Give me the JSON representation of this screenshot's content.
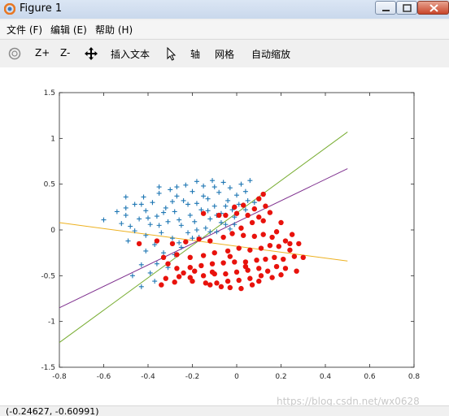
{
  "window": {
    "title": "Figure 1"
  },
  "menu": {
    "items": [
      {
        "label": "文件 (F)"
      },
      {
        "label": "编辑 (E)"
      },
      {
        "label": "帮助 (H)"
      }
    ]
  },
  "toolbar": {
    "zoom_in_label": "Z+",
    "zoom_out_label": "Z-",
    "insert_text_label": "插入文本",
    "axis_label": "轴",
    "grid_label": "网格",
    "autoscale_label": "自动缩放",
    "icons": [
      "rotate-icon",
      "pan-icon",
      "pointer-icon"
    ]
  },
  "status": {
    "coordinates": "(-0.24627, -0.60991)"
  },
  "watermark": {
    "text": "https://blog.csdn.net/wx0628"
  },
  "colors": {
    "class_a": "#1f77b4",
    "class_b": "#e8120c",
    "line_green": "#77ac30",
    "line_purple": "#7e2f8e",
    "line_orange": "#edb120"
  },
  "chart_data": {
    "type": "scatter",
    "title": "",
    "xlabel": "",
    "ylabel": "",
    "xlim": [
      -0.8,
      0.8
    ],
    "ylim": [
      -1.5,
      1.5
    ],
    "xticks": [
      "-0.8",
      "-0.6",
      "-0.4",
      "-0.2",
      "0",
      "0.2",
      "0.4",
      "0.6",
      "0.8"
    ],
    "yticks": [
      "1.5",
      "1",
      "0.5",
      "0",
      "-0.5",
      "-1",
      "-1.5"
    ],
    "grid": false,
    "series": [
      {
        "marker": "plus",
        "color": "#1f77b4",
        "points": [
          [
            -0.6,
            0.11
          ],
          [
            -0.54,
            0.2
          ],
          [
            -0.52,
            0.07
          ],
          [
            -0.5,
            0.16
          ],
          [
            -0.5,
            0.36
          ],
          [
            -0.49,
            -0.12
          ],
          [
            -0.48,
            0.04
          ],
          [
            -0.46,
            -0.01
          ],
          [
            -0.46,
            0.28
          ],
          [
            -0.44,
            0.12
          ],
          [
            -0.42,
            0.36
          ],
          [
            -0.41,
            -0.23
          ],
          [
            -0.41,
            0.21
          ],
          [
            -0.39,
            0.06
          ],
          [
            -0.38,
            0.3
          ],
          [
            -0.37,
            -0.16
          ],
          [
            -0.36,
            0.15
          ],
          [
            -0.35,
            0.4
          ],
          [
            -0.34,
            -0.03
          ],
          [
            -0.33,
            -0.25
          ],
          [
            -0.32,
            0.24
          ],
          [
            -0.31,
            0.09
          ],
          [
            -0.3,
            0.44
          ],
          [
            -0.29,
            -0.09
          ],
          [
            -0.28,
            0.2
          ],
          [
            -0.27,
            0.37
          ],
          [
            -0.26,
            -0.14
          ],
          [
            -0.25,
            0.05
          ],
          [
            -0.24,
            0.32
          ],
          [
            -0.23,
            0.49
          ],
          [
            -0.22,
            -0.03
          ],
          [
            -0.21,
            0.16
          ],
          [
            -0.2,
            0.42
          ],
          [
            -0.19,
            0.09
          ],
          [
            -0.18,
            0.29
          ],
          [
            -0.17,
            -0.08
          ],
          [
            -0.16,
            0.22
          ],
          [
            -0.15,
            0.48
          ],
          [
            -0.14,
            0.02
          ],
          [
            -0.13,
            0.34
          ],
          [
            -0.12,
            0.12
          ],
          [
            -0.11,
            0.54
          ],
          [
            -0.1,
            0.26
          ],
          [
            -0.09,
            -0.02
          ],
          [
            -0.08,
            0.41
          ],
          [
            -0.07,
            0.18
          ],
          [
            -0.06,
            0.52
          ],
          [
            -0.05,
            0.06
          ],
          [
            -0.04,
            0.32
          ],
          [
            -0.03,
            0.46
          ],
          [
            -0.02,
            0.22
          ],
          [
            -0.01,
            0.14
          ],
          [
            0.0,
            0.38
          ],
          [
            0.01,
            0.28
          ],
          [
            0.02,
            0.5
          ],
          [
            0.04,
            0.42
          ],
          [
            0.05,
            0.32
          ],
          [
            0.06,
            0.54
          ],
          [
            -0.37,
            -0.56
          ],
          [
            -0.43,
            -0.38
          ],
          [
            -0.47,
            -0.5
          ],
          [
            -0.39,
            -0.47
          ],
          [
            -0.25,
            -0.19
          ],
          [
            -0.36,
            -0.37
          ],
          [
            -0.28,
            -0.27
          ],
          [
            -0.43,
            -0.62
          ],
          [
            -0.31,
            -0.41
          ],
          [
            -0.2,
            -0.09
          ],
          [
            -0.5,
            0.24
          ],
          [
            -0.43,
            0.28
          ],
          [
            -0.35,
            0.47
          ],
          [
            -0.27,
            0.47
          ],
          [
            -0.18,
            0.53
          ],
          [
            -0.1,
            0.47
          ],
          [
            -0.15,
            0.37
          ],
          [
            -0.22,
            0.28
          ],
          [
            -0.05,
            0.26
          ],
          [
            -0.03,
            0.01
          ],
          [
            -0.07,
            0.08
          ],
          [
            -0.12,
            -0.02
          ],
          [
            -0.18,
            0.0
          ],
          [
            -0.26,
            0.11
          ],
          [
            -0.35,
            0.05
          ],
          [
            -0.41,
            -0.06
          ],
          [
            -0.4,
            0.13
          ],
          [
            -0.33,
            0.19
          ],
          [
            -0.29,
            0.31
          ],
          [
            -0.13,
            0.21
          ],
          [
            -0.09,
            0.16
          ],
          [
            0.04,
            0.22
          ],
          [
            0.08,
            0.3
          ],
          [
            -0.01,
            0.06
          ]
        ]
      },
      {
        "marker": "dot",
        "color": "#e8120c",
        "points": [
          [
            0.12,
            0.39
          ],
          [
            0.1,
            0.34
          ],
          [
            0.13,
            0.26
          ],
          [
            0.08,
            0.23
          ],
          [
            0.03,
            0.27
          ],
          [
            -0.01,
            0.25
          ],
          [
            0.15,
            0.19
          ],
          [
            0.1,
            0.14
          ],
          [
            0.05,
            0.16
          ],
          [
            0.0,
            0.18
          ],
          [
            -0.05,
            0.16
          ],
          [
            -0.08,
            0.16
          ],
          [
            -0.15,
            0.18
          ],
          [
            0.12,
            0.1
          ],
          [
            0.07,
            0.08
          ],
          [
            0.02,
            0.02
          ],
          [
            0.2,
            0.08
          ],
          [
            0.18,
            -0.02
          ],
          [
            0.12,
            -0.05
          ],
          [
            0.08,
            -0.07
          ],
          [
            0.03,
            -0.06
          ],
          [
            -0.02,
            -0.04
          ],
          [
            -0.06,
            -0.08
          ],
          [
            -0.12,
            -0.12
          ],
          [
            -0.17,
            -0.1
          ],
          [
            -0.23,
            -0.13
          ],
          [
            -0.29,
            -0.15
          ],
          [
            -0.36,
            -0.12
          ],
          [
            -0.44,
            -0.15
          ],
          [
            0.25,
            -0.05
          ],
          [
            0.22,
            -0.12
          ],
          [
            0.28,
            -0.15
          ],
          [
            0.19,
            -0.18
          ],
          [
            0.15,
            -0.17
          ],
          [
            0.11,
            -0.2
          ],
          [
            0.06,
            -0.22
          ],
          [
            0.01,
            -0.2
          ],
          [
            -0.04,
            -0.23
          ],
          [
            -0.1,
            -0.25
          ],
          [
            -0.15,
            -0.28
          ],
          [
            -0.21,
            -0.3
          ],
          [
            -0.27,
            -0.27
          ],
          [
            -0.33,
            -0.3
          ],
          [
            0.3,
            -0.3
          ],
          [
            0.26,
            -0.29
          ],
          [
            0.24,
            -0.22
          ],
          [
            0.21,
            -0.32
          ],
          [
            0.17,
            -0.3
          ],
          [
            0.13,
            -0.32
          ],
          [
            0.09,
            -0.33
          ],
          [
            0.04,
            -0.35
          ],
          [
            -0.01,
            -0.35
          ],
          [
            -0.06,
            -0.36
          ],
          [
            -0.11,
            -0.37
          ],
          [
            -0.16,
            -0.39
          ],
          [
            -0.21,
            -0.41
          ],
          [
            -0.27,
            -0.42
          ],
          [
            -0.31,
            -0.37
          ],
          [
            0.27,
            -0.45
          ],
          [
            0.22,
            -0.42
          ],
          [
            0.18,
            -0.4
          ],
          [
            0.14,
            -0.45
          ],
          [
            0.1,
            -0.42
          ],
          [
            0.05,
            -0.44
          ],
          [
            0.0,
            -0.46
          ],
          [
            -0.05,
            -0.48
          ],
          [
            -0.1,
            -0.48
          ],
          [
            -0.15,
            -0.5
          ],
          [
            -0.21,
            -0.52
          ],
          [
            -0.26,
            -0.51
          ],
          [
            -0.32,
            -0.53
          ],
          [
            0.2,
            -0.49
          ],
          [
            0.16,
            -0.52
          ],
          [
            0.11,
            -0.5
          ],
          [
            0.06,
            -0.53
          ],
          [
            0.01,
            -0.55
          ],
          [
            -0.04,
            -0.56
          ],
          [
            -0.09,
            -0.58
          ],
          [
            -0.14,
            -0.58
          ],
          [
            -0.2,
            -0.56
          ],
          [
            -0.34,
            -0.6
          ],
          [
            -0.28,
            -0.57
          ],
          [
            0.07,
            -0.6
          ],
          [
            0.02,
            -0.64
          ],
          [
            -0.03,
            -0.63
          ],
          [
            -0.07,
            -0.62
          ],
          [
            -0.12,
            -0.6
          ],
          [
            0.1,
            -0.56
          ],
          [
            0.04,
            -0.4
          ],
          [
            -0.11,
            -0.46
          ],
          [
            -0.19,
            -0.45
          ],
          [
            -0.24,
            -0.47
          ],
          [
            -0.03,
            -0.29
          ],
          [
            0.16,
            -0.08
          ],
          [
            0.24,
            -0.15
          ]
        ]
      }
    ],
    "lines": [
      {
        "color": "#77ac30",
        "points": [
          [
            -0.8,
            -1.23
          ],
          [
            0.5,
            1.07
          ]
        ]
      },
      {
        "color": "#7e2f8e",
        "points": [
          [
            -0.8,
            -0.85
          ],
          [
            0.5,
            0.67
          ]
        ]
      },
      {
        "color": "#edb120",
        "points": [
          [
            -0.8,
            0.08
          ],
          [
            0.5,
            -0.34
          ]
        ]
      }
    ]
  }
}
